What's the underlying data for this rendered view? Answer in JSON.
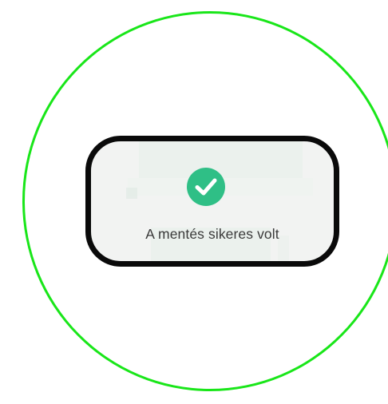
{
  "toast": {
    "icon": "checkmark-icon",
    "message": "A mentés sikeres volt"
  },
  "colors": {
    "highlight_ring": "#19e619",
    "toast_border": "#0a0a0a",
    "check_circle": "#2fbf86",
    "toast_background": "#f2f3f2"
  }
}
